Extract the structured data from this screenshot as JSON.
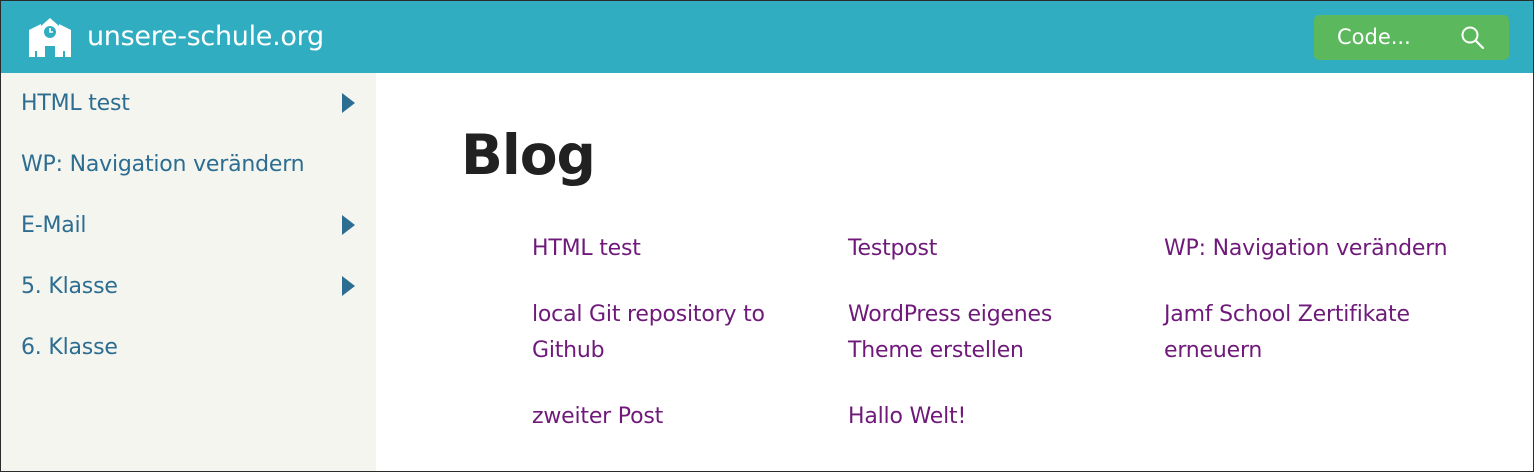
{
  "header": {
    "site_title": "unsere-schule.org",
    "search_label": "Code...",
    "colors": {
      "bar": "#30adc0",
      "search_button": "#5cb85c"
    },
    "icons": {
      "logo": "school-building-icon",
      "search": "magnifier-icon"
    }
  },
  "sidebar": {
    "items": [
      {
        "label": "HTML test",
        "has_submenu": true
      },
      {
        "label": "WP: Navigation verändern",
        "has_submenu": false
      },
      {
        "label": "E-Mail",
        "has_submenu": true
      },
      {
        "label": "5. Klasse",
        "has_submenu": true
      },
      {
        "label": "6. Klasse",
        "has_submenu": false
      }
    ],
    "colors": {
      "background": "#f5f5ef",
      "link": "#2c6d91"
    }
  },
  "main": {
    "title": "Blog",
    "posts": [
      "HTML test",
      "Testpost",
      "WP: Navigation verändern",
      "local Git repository to Github",
      "WordPress eigenes Theme erstellen",
      "Jamf School Zertifikate erneuern",
      "zweiter Post",
      "Hallo Welt!"
    ],
    "colors": {
      "post_link": "#6f1a7a",
      "title": "#212121"
    }
  }
}
